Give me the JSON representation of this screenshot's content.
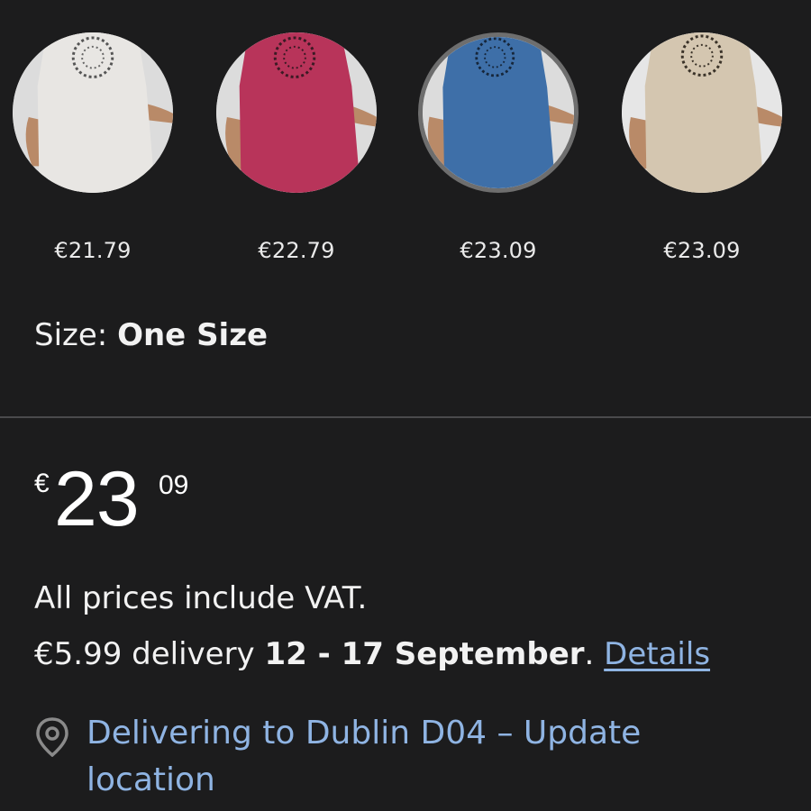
{
  "variants": [
    {
      "price": "€21.79",
      "color_name": "white",
      "color": "#e8e6e3",
      "selected": false
    },
    {
      "price": "€22.79",
      "color_name": "rose",
      "color": "#b8345a",
      "selected": false
    },
    {
      "price": "€23.09",
      "color_name": "blue",
      "color": "#3e6fa8",
      "selected": true
    },
    {
      "price": "€23.09",
      "color_name": "beige",
      "color": "#d4c6b0",
      "selected": false
    }
  ],
  "size": {
    "label": "Size: ",
    "value": "One Size"
  },
  "price": {
    "currency": "€",
    "whole": "23",
    "fraction": "09"
  },
  "vat_text": "All prices include VAT.",
  "delivery": {
    "prefix": "€5.99 delivery ",
    "dates": "12 - 17 September",
    "suffix": ". ",
    "details_link": "Details"
  },
  "location": {
    "icon": "location-pin-icon",
    "text": "Delivering to Dublin D04 – Update location"
  },
  "colors": {
    "background": "#1c1c1d",
    "link": "#8fb4e3",
    "divider": "#4a4a4c",
    "selected_ring": "#6e6e6e"
  }
}
